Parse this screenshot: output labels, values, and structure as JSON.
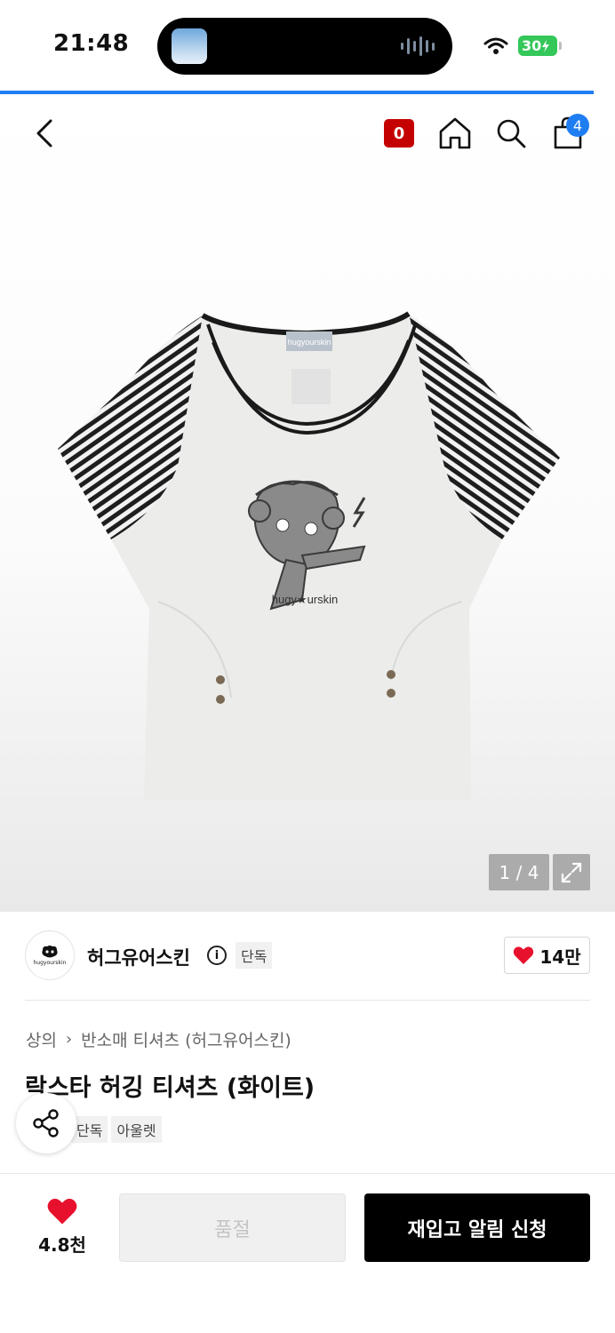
{
  "status_bar": {
    "time": "21:48",
    "battery": "30"
  },
  "nav": {
    "badge": "0",
    "cart_count": "4"
  },
  "gallery": {
    "counter": "1 / 4",
    "print_text": "hugy★urskin",
    "label_text": "hugyourskin"
  },
  "brand": {
    "name": "허그유어스킨",
    "logo_text": "hugyourskin",
    "exclusive_chip": "단독",
    "likes": "14만"
  },
  "product": {
    "breadcrumb": [
      "상의",
      "반소매 티셔츠 (허그유어스킨)"
    ],
    "title": "락스타 허깅 티셔츠 (화이트)",
    "tags": [
      "단독",
      "아울렛"
    ]
  },
  "bottom_bar": {
    "wish_count": "4.8천",
    "soldout_label": "품절",
    "restock_label": "재입고 알림 신청"
  },
  "colors": {
    "accent_blue": "#1f7df2",
    "badge_red": "#c40000",
    "heart_red": "#e8112d",
    "battery_green": "#34c759"
  }
}
